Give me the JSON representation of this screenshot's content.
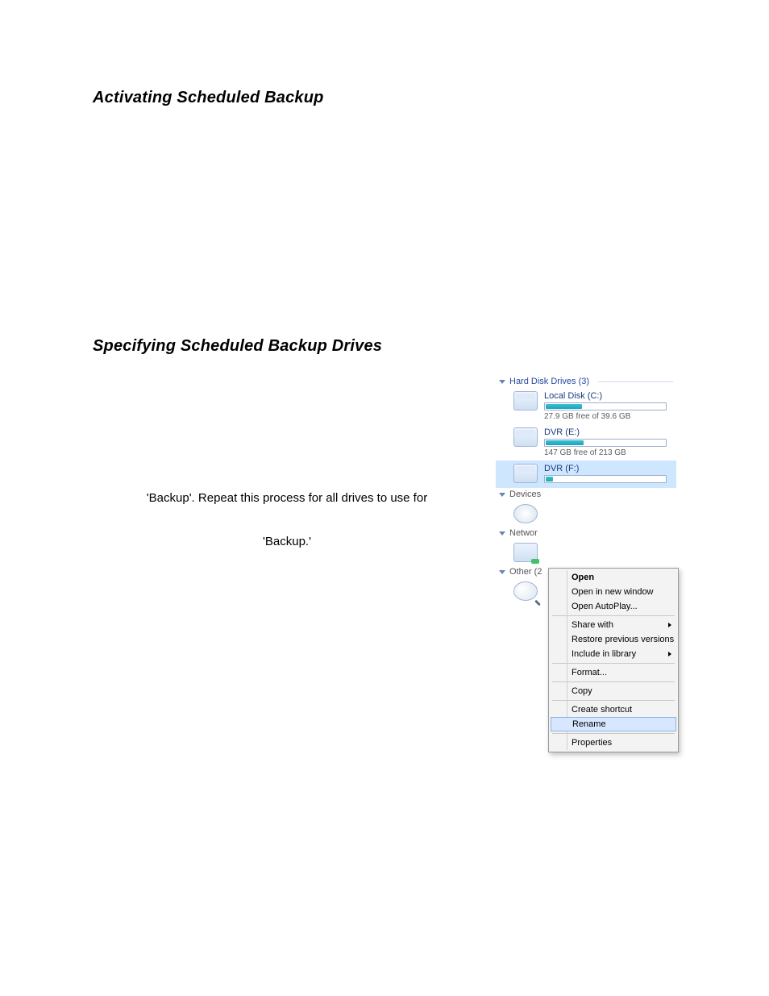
{
  "headings": {
    "activating": "Activating Scheduled Backup",
    "specifying": "Specifying Scheduled Backup Drives"
  },
  "body": {
    "line1": "'Backup'. Repeat this process for all drives to use for",
    "line2": "'Backup.'"
  },
  "explorer": {
    "groups": {
      "hdd": "Hard Disk Drives (3)",
      "devices_cut": "Devices",
      "network_cut": "Networ",
      "other_cut": "Other (2"
    },
    "drives": [
      {
        "name": "Local Disk (C:)",
        "free": "27.9 GB free of 39.6 GB",
        "fill_pct": 30
      },
      {
        "name": "DVR (E:)",
        "free": "147 GB free of 213 GB",
        "fill_pct": 31
      },
      {
        "name": "DVR (F:)",
        "free": "",
        "fill_pct": 6,
        "selected": true
      }
    ]
  },
  "context_menu": [
    {
      "label": "Open",
      "bold": true
    },
    {
      "label": "Open in new window"
    },
    {
      "label": "Open AutoPlay..."
    },
    {
      "sep": true
    },
    {
      "label": "Share with",
      "submenu": true
    },
    {
      "label": "Restore previous versions"
    },
    {
      "label": "Include in library",
      "submenu": true
    },
    {
      "sep": true
    },
    {
      "label": "Format..."
    },
    {
      "sep": true
    },
    {
      "label": "Copy"
    },
    {
      "sep": true
    },
    {
      "label": "Create shortcut"
    },
    {
      "label": "Rename",
      "selected": true
    },
    {
      "sep": true
    },
    {
      "label": "Properties"
    }
  ]
}
